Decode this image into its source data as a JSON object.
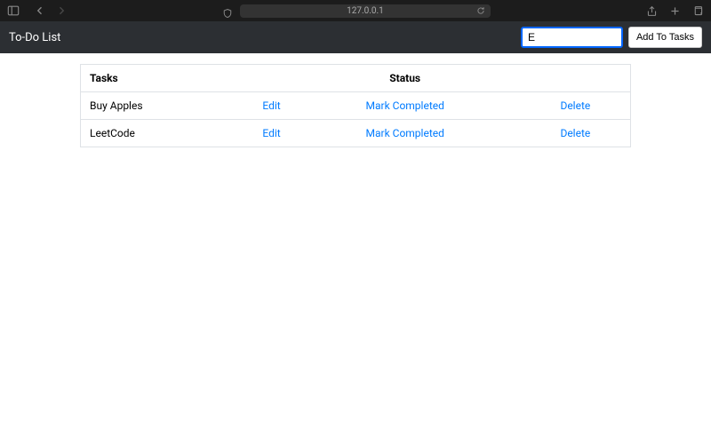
{
  "browser": {
    "url": "127.0.0.1"
  },
  "app": {
    "title": "To-Do List",
    "input_value": "E",
    "add_button": "Add To Tasks"
  },
  "table": {
    "headers": {
      "tasks": "Tasks",
      "status": "Status"
    },
    "actions": {
      "edit": "Edit",
      "mark": "Mark Completed",
      "delete": "Delete"
    },
    "rows": [
      {
        "name": "Buy Apples"
      },
      {
        "name": "LeetCode"
      }
    ]
  }
}
